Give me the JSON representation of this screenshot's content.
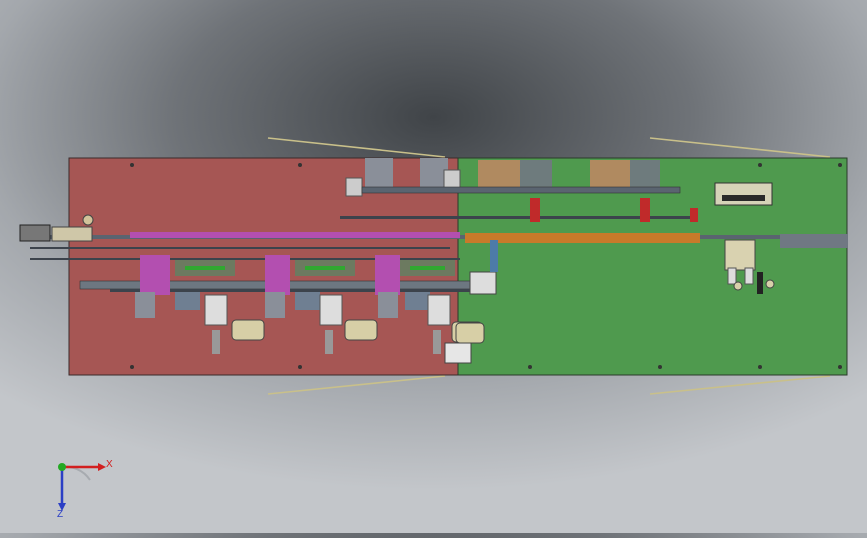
{
  "viewport": {
    "background_top": "#3e4246",
    "background_bottom": "#c4c7cb"
  },
  "assembly": {
    "left_plate_color": "#a65654",
    "right_plate_color": "#4f9a4e",
    "rail_color": "#5a6470",
    "accent_magenta": "#b34fb0",
    "accent_orange": "#c87a2a",
    "accent_red": "#c02a2a"
  },
  "triad": {
    "x_label": "X",
    "z_label": "Z",
    "x_color": "#d21f1f",
    "y_color": "#23a923",
    "z_color": "#2b3fc5"
  }
}
